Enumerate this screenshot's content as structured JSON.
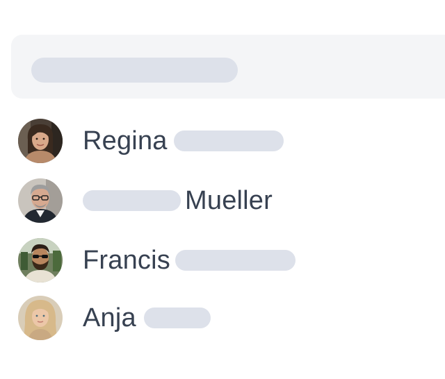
{
  "people": [
    {
      "first_name": "Regina",
      "last_name": ""
    },
    {
      "first_name": "",
      "last_name": "Mueller"
    },
    {
      "first_name": "Francis",
      "last_name": ""
    },
    {
      "first_name": "Anja",
      "last_name": ""
    }
  ],
  "colors": {
    "panel_background": "#f4f5f7",
    "skeleton": "#dde1ea",
    "text": "#374151"
  },
  "icons": [
    "avatar-regina",
    "avatar-mueller",
    "avatar-francis",
    "avatar-anja"
  ]
}
